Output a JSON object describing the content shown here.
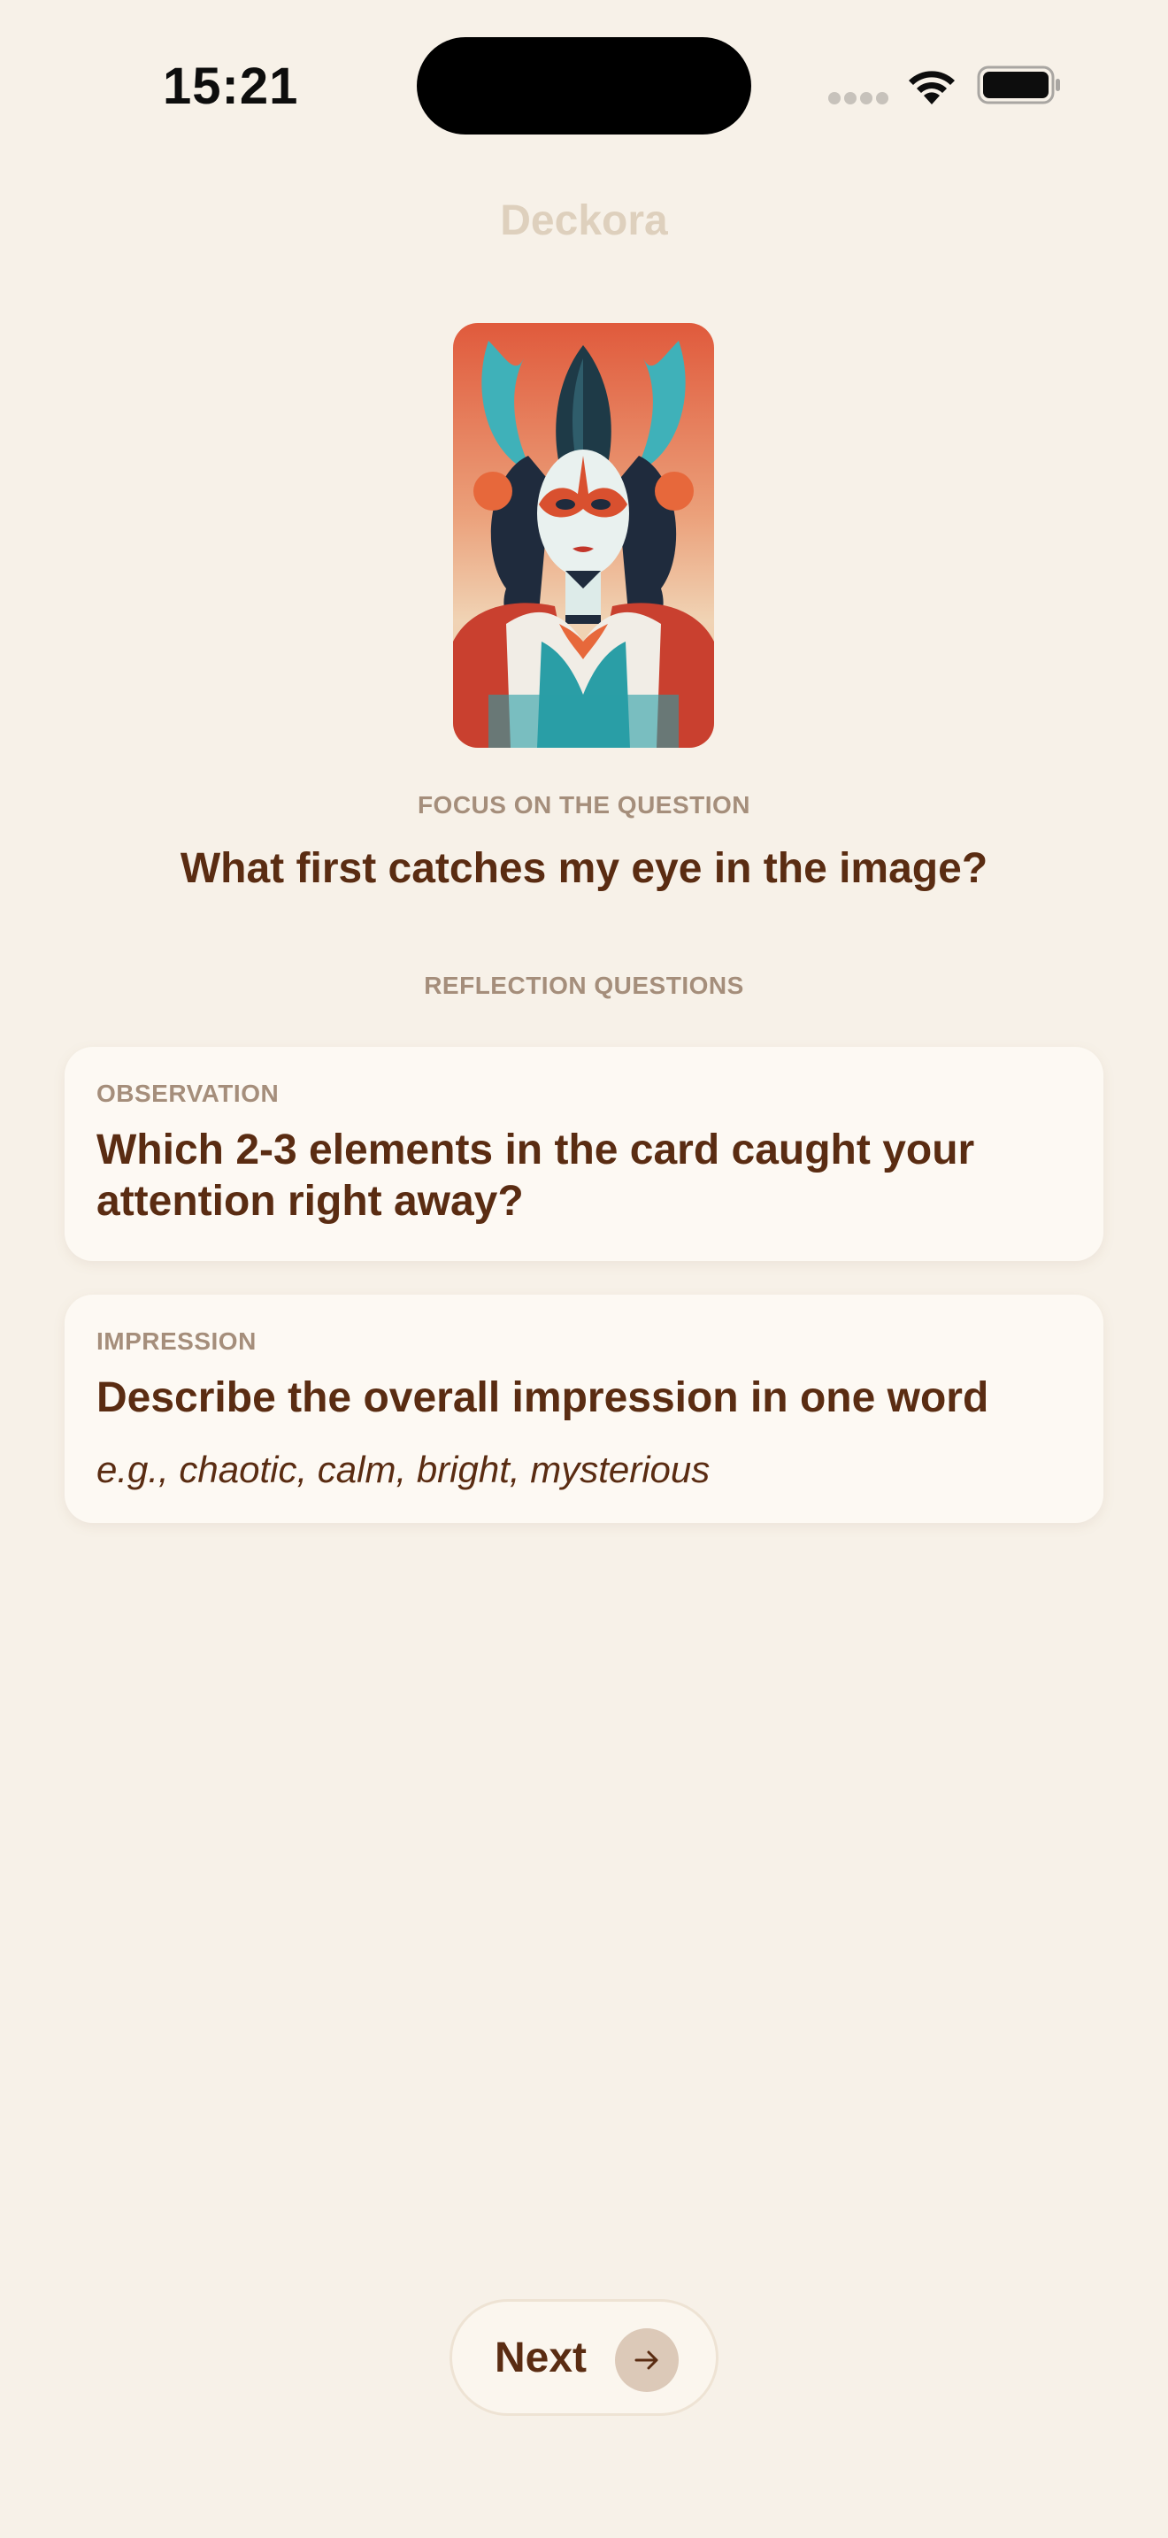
{
  "status_bar": {
    "time": "15:21"
  },
  "header": {
    "title": "Deckora"
  },
  "focus": {
    "label": "FOCUS ON THE QUESTION",
    "question": "What first catches my eye in the image?"
  },
  "reflection": {
    "label": "REFLECTION QUESTIONS",
    "cards": [
      {
        "category": "OBSERVATION",
        "question": "Which 2-3 elements in the card caught your attention right away?"
      },
      {
        "category": "IMPRESSION",
        "question": "Describe the overall impression in one word",
        "hint": "e.g., chaotic, calm, bright, mysterious"
      }
    ]
  },
  "footer": {
    "next_label": "Next"
  },
  "icons": {
    "wifi": "wifi-icon",
    "battery": "battery-icon",
    "signal": "signal-dots-icon",
    "next_arrow": "arrow-right-icon"
  },
  "colors": {
    "background": "#f7f1e8",
    "text_primary": "#5a2c12",
    "text_muted": "#a58e7b",
    "title_faded": "#ded0bd",
    "card_bg": "#fdf9f3",
    "button_accent": "#dcc9b8"
  }
}
